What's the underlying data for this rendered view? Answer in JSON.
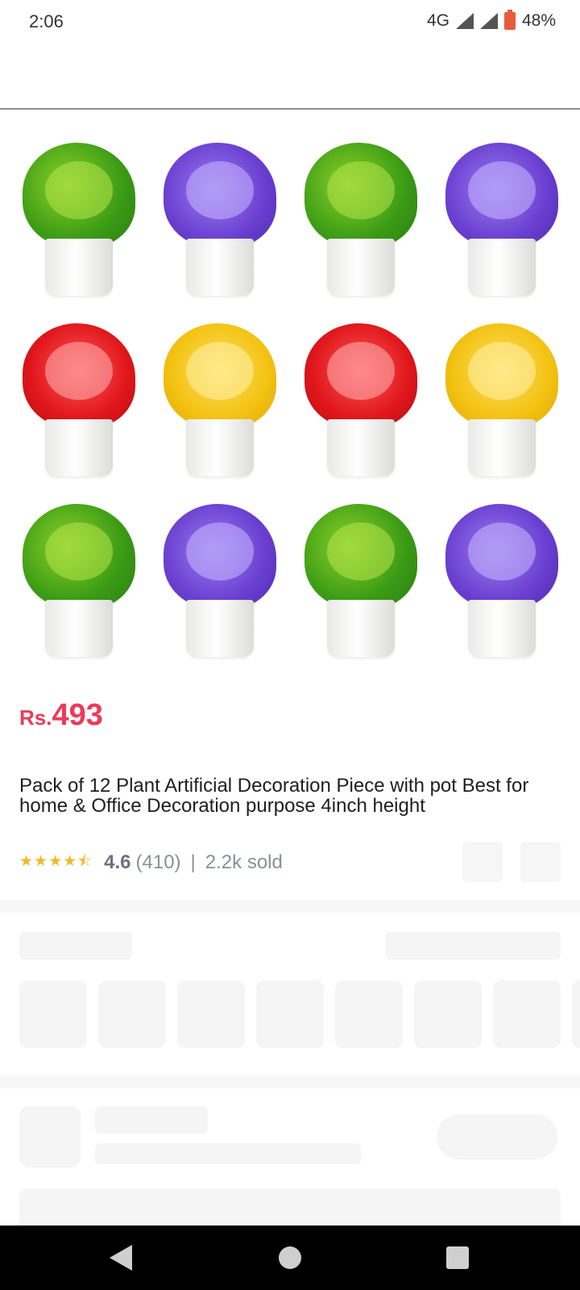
{
  "status_bar": {
    "time": "2:06",
    "network": "4G",
    "battery": "48%"
  },
  "product": {
    "image_alt": "Artificial potted plants in green, purple, red and yellow",
    "price_currency": "Rs.",
    "price_value": "493",
    "title": "Pack of 12 Plant Artificial Decoration Piece with pot Best for home & Office Decoration purpose 4inch height",
    "rating_stars": "★★★★⯪",
    "rating": "4.6",
    "review_count": "(410)",
    "separator": "|",
    "sold": "2.2k sold"
  },
  "plants": [
    "green",
    "purple",
    "green",
    "purple",
    "red",
    "yellow",
    "red",
    "yellow",
    "green",
    "purple",
    "green",
    "purple"
  ],
  "colors": {
    "price": "#ee3a5a",
    "star": "#f5b82e",
    "skeleton": "#f5f5f5"
  },
  "nav": {
    "icons": [
      "back-icon",
      "home-icon",
      "recent-apps-icon"
    ]
  }
}
